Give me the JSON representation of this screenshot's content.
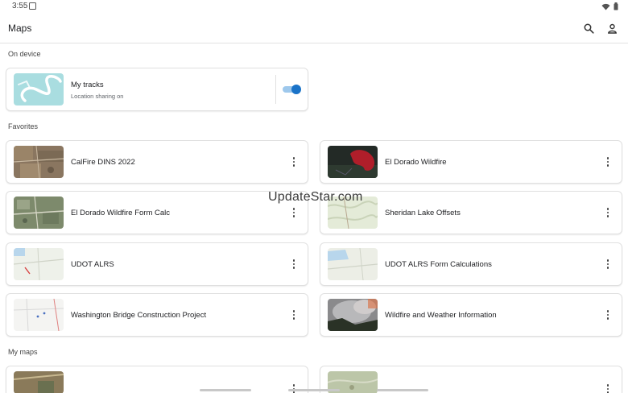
{
  "status": {
    "time": "3:55"
  },
  "app": {
    "title": "Maps"
  },
  "icons": {
    "search": "search-icon",
    "account": "account-icon",
    "more": "more-vert-icon"
  },
  "sections": {
    "on_device": "On device",
    "favorites": "Favorites",
    "my_maps": "My maps"
  },
  "tracks": {
    "title": "My tracks",
    "subtitle": "Location sharing on",
    "sharing_enabled": true
  },
  "favorites": [
    {
      "title": "CalFire DINS 2022"
    },
    {
      "title": "El Dorado Wildfire"
    },
    {
      "title": "El Dorado Wildfire Form Calc"
    },
    {
      "title": "Sheridan Lake Offsets"
    },
    {
      "title": "UDOT ALRS"
    },
    {
      "title": "UDOT ALRS Form Calculations"
    },
    {
      "title": "Washington Bridge Construction Project"
    },
    {
      "title": "Wildfire and Weather Information"
    }
  ],
  "watermark": "UpdateStar.com",
  "colors": {
    "accent": "#1a73c8",
    "toggle_track": "#9ec8ec"
  }
}
